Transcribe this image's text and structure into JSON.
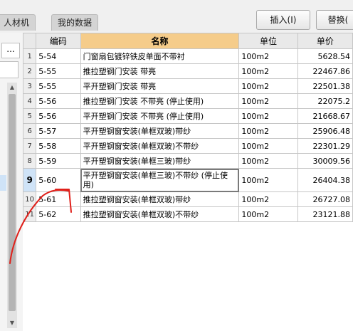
{
  "tabs": [
    "人材机",
    "我的数据"
  ],
  "buttons": {
    "insert": "插入(I)",
    "replace": "替换("
  },
  "left_panel": {
    "more_button": "..."
  },
  "table": {
    "headers": [
      "编码",
      "名称",
      "单位",
      "单价"
    ],
    "rows": [
      {
        "idx": "1",
        "code": "5-54",
        "name": "门窗扇包镀锌铁皮单面不带衬",
        "unit": "100m2",
        "price": "5628.54"
      },
      {
        "idx": "2",
        "code": "5-55",
        "name": "推拉塑钢门安装 带亮",
        "unit": "100m2",
        "price": "22467.86"
      },
      {
        "idx": "3",
        "code": "5-55",
        "name": "平开塑钢门安装 带亮",
        "unit": "100m2",
        "price": "22501.38"
      },
      {
        "idx": "4",
        "code": "5-56",
        "name": "推拉塑钢门安装 不带亮 (停止使用)",
        "unit": "100m2",
        "price": "22075.2"
      },
      {
        "idx": "5",
        "code": "5-56",
        "name": "平开塑钢门安装 不带亮 (停止使用)",
        "unit": "100m2",
        "price": "21668.67"
      },
      {
        "idx": "6",
        "code": "5-57",
        "name": "平开塑钢窗安装(单框双玻)带纱",
        "unit": "100m2",
        "price": "25906.48"
      },
      {
        "idx": "7",
        "code": "5-58",
        "name": "平开塑钢窗安装(单框双玻)不带纱",
        "unit": "100m2",
        "price": "22301.29"
      },
      {
        "idx": "8",
        "code": "5-59",
        "name": "平开塑钢窗安装(单框三玻)带纱",
        "unit": "100m2",
        "price": "30009.56"
      },
      {
        "idx": "9",
        "code": "5-60",
        "name": "平开塑钢窗安装(单框三玻)不带纱 (停止使用)",
        "unit": "100m2",
        "price": "26404.38"
      },
      {
        "idx": "10",
        "code": "5-61",
        "name": "推拉塑钢窗安装(单框双玻)带纱",
        "unit": "100m2",
        "price": "26727.08"
      },
      {
        "idx": "11",
        "code": "5-62",
        "name": "推拉塑钢窗安装(单框双玻)不带纱",
        "unit": "100m2",
        "price": "23121.88"
      }
    ]
  }
}
